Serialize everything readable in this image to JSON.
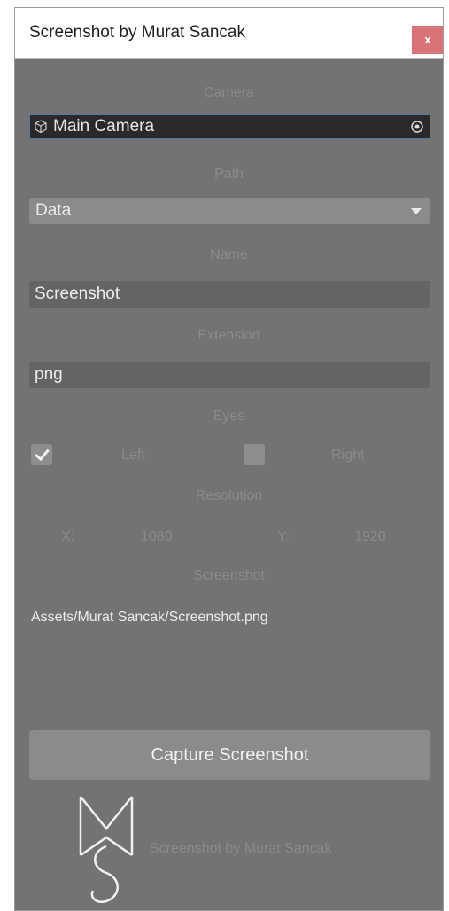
{
  "window": {
    "title": "Screenshot by Murat Sancak",
    "close_label": "x"
  },
  "camera": {
    "label": "Camera",
    "value": "Main Camera",
    "icon": "camera-cube-icon",
    "picker_icon": "target-icon"
  },
  "path": {
    "label": "Path",
    "selected": "Data"
  },
  "name": {
    "label": "Name",
    "value": "Screenshot"
  },
  "extension": {
    "label": "Extension",
    "value": "png"
  },
  "eyes": {
    "label": "Eyes",
    "left_label": "Left",
    "left_checked": true,
    "right_label": "Right",
    "right_checked": false
  },
  "resolution": {
    "label": "Resolution",
    "x_label": "X:",
    "x_value": "1080",
    "y_label": "Y:",
    "y_value": "1920"
  },
  "screenshot": {
    "label": "Screenshot",
    "path": "Assets/Murat Sancak/Screenshot.png"
  },
  "actions": {
    "capture_label": "Capture Screenshot"
  },
  "footer": {
    "logo_icon": "ms-logo-icon",
    "caption": "Screenshot by Murat Sancak"
  },
  "colors": {
    "panel_bg": "#737373",
    "field_bg": "#646464",
    "button_bg": "#8b8b8b",
    "close_bg": "#d9737a",
    "selected_border": "#4f7aa5"
  }
}
